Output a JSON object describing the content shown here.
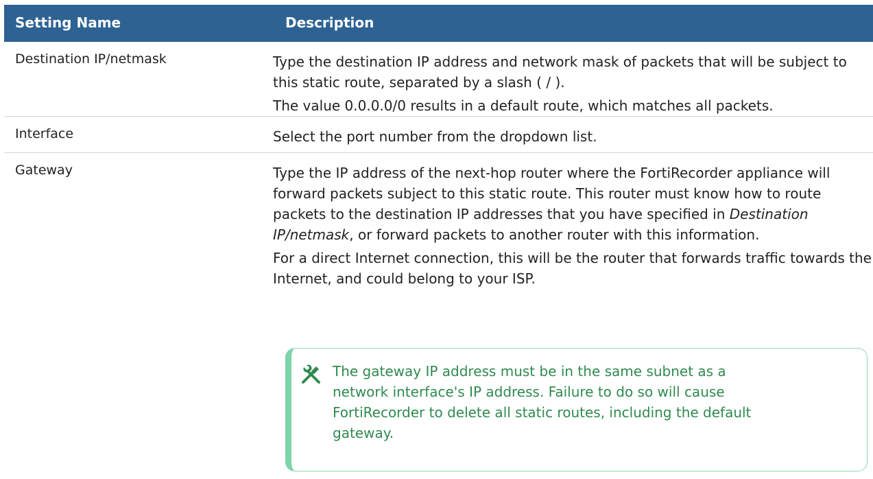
{
  "header": {
    "col1": "Setting Name",
    "col2": "Description"
  },
  "rows": [
    {
      "name": "Destination IP/netmask",
      "desc1": "Type the destination IP address and network mask of packets that will be subject to this static route, separated by a slash ( / ).",
      "desc2": "The value 0.0.0.0/0 results in a default route, which matches all packets."
    },
    {
      "name": "Interface",
      "desc1": "Select the port number from the dropdown list."
    },
    {
      "name": "Gateway",
      "desc1_pre": "Type the IP address of the next-hop router where the FortiRecorder appliance will forward packets subject to this static route. This router must know how to route packets to the destination IP addresses that you have specified in ",
      "desc1_em": "Destination IP/netmask",
      "desc1_post": ", or forward packets to another router with this information.",
      "desc2": "For a direct Internet connection, this will be the router that forwards traffic towards the Internet, and could belong to your ISP.",
      "note": {
        "icon": "wrench-screwdriver-icon",
        "text": "The gateway IP address must be in the same subnet as a network interface's IP address. Failure to do so will cause FortiRecorder to delete all static routes, including the default gateway."
      }
    }
  ],
  "colors": {
    "header_bg": "#2d6293",
    "note_accent": "#7dd3aa",
    "note_text": "#2f8a4f"
  }
}
